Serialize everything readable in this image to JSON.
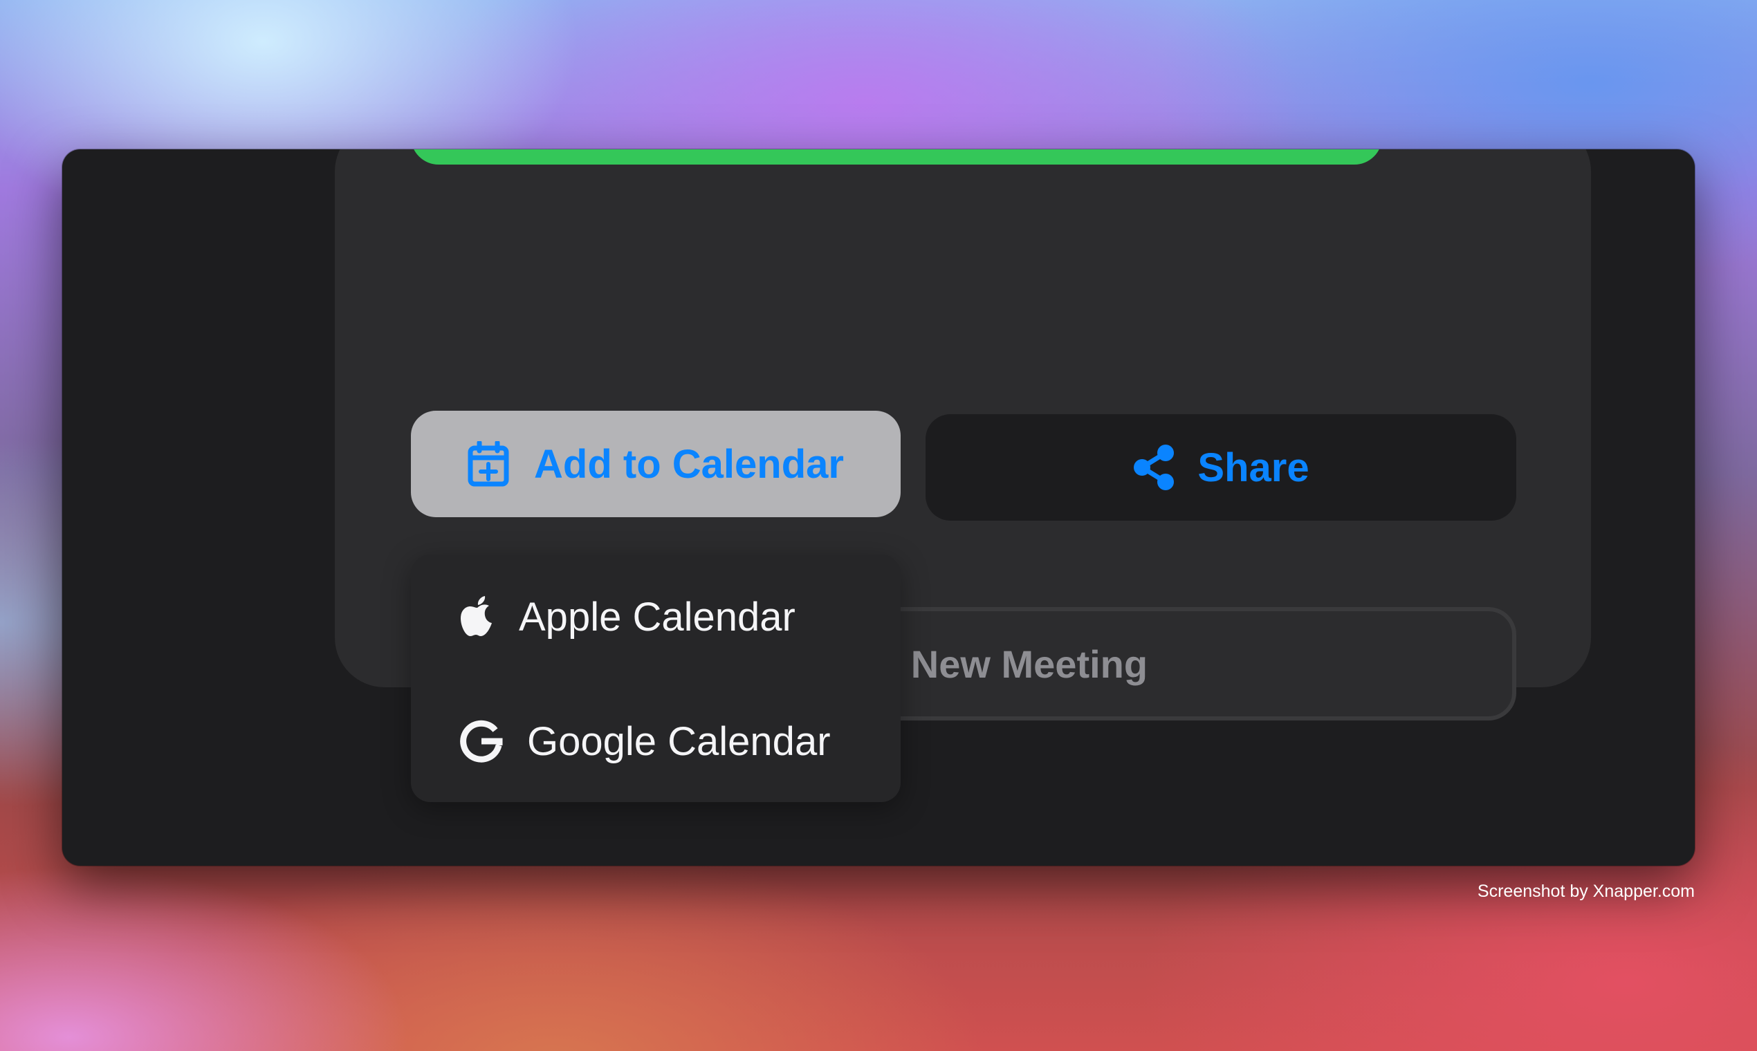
{
  "actions": {
    "add_to_calendar_label": "Add to Calendar",
    "share_label": "Share",
    "new_meeting_label": "Create New Meeting"
  },
  "calendar_menu": {
    "items": [
      {
        "label": "Apple Calendar",
        "icon": "apple-icon"
      },
      {
        "label": "Google Calendar",
        "icon": "google-icon"
      }
    ]
  },
  "progress": {
    "value": 1.0,
    "color": "#34c759"
  },
  "colors": {
    "accent": "#0a84ff",
    "card": "#2c2c2e",
    "window": "#1d1d1f"
  },
  "watermark": "Screenshot by Xnapper.com"
}
